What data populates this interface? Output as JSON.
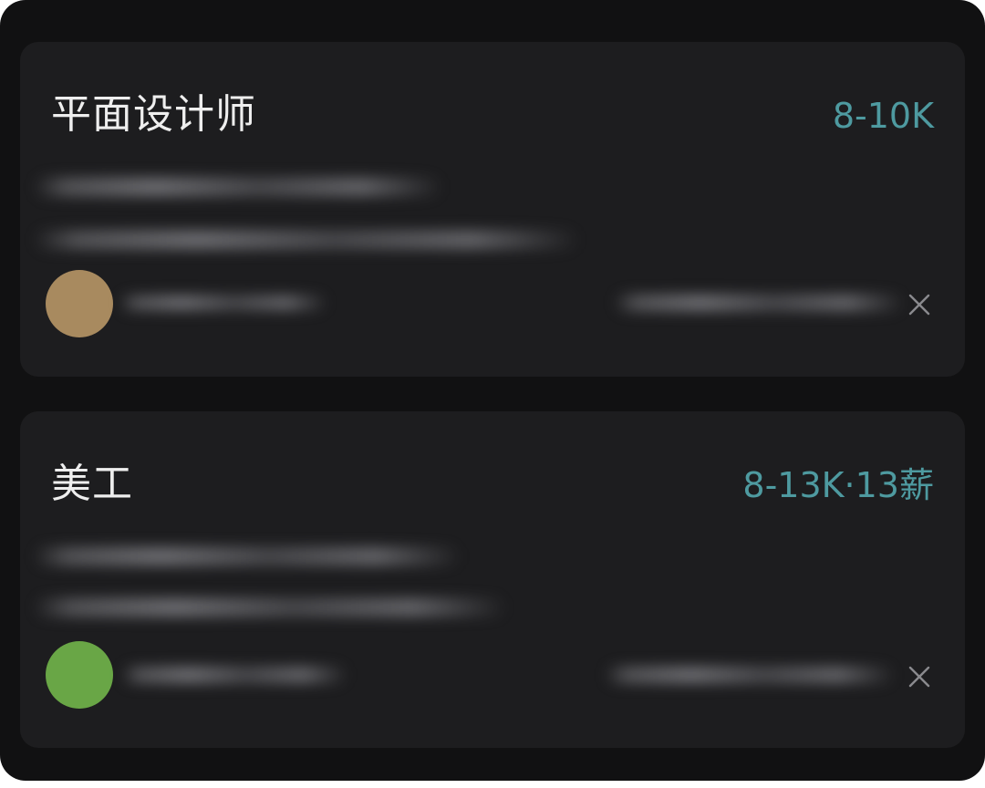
{
  "jobs": [
    {
      "title": "平面设计师",
      "salary": "8-10K",
      "avatar_color": "#a88a5f",
      "close_icon": "close-icon"
    },
    {
      "title": "美工",
      "salary": "8-13K·13薪",
      "avatar_color": "#69a646",
      "close_icon": "close-icon"
    }
  ],
  "colors": {
    "background": "#111112",
    "card": "#1d1d1f",
    "title": "#eeeeee",
    "salary": "#4e9aa0"
  }
}
